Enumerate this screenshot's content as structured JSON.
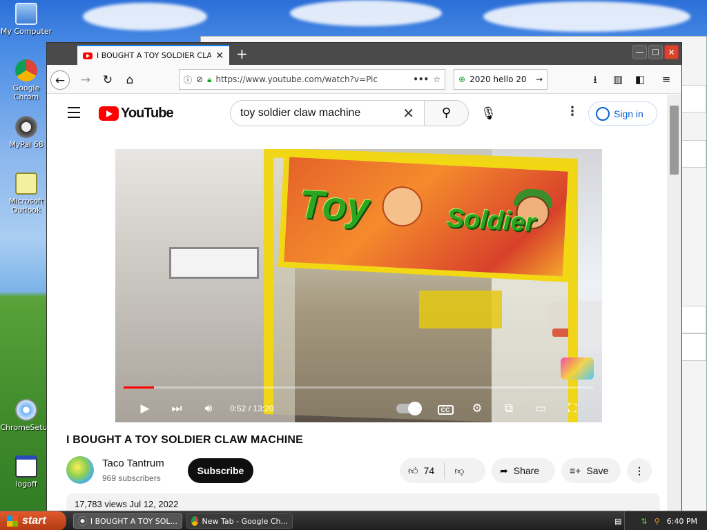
{
  "desktop": {
    "icons": [
      {
        "label": "My Computer",
        "icon": "computer-icon"
      },
      {
        "label": "Google Chrom",
        "icon": "chrome-icon"
      },
      {
        "label": "MyPal 68",
        "icon": "raccoon-icon"
      },
      {
        "label": "Microsoft Outlook",
        "icon": "outlook-icon"
      },
      {
        "label": "ChromeSetup",
        "icon": "setup-icon"
      },
      {
        "label": "logoff",
        "icon": "logoff-icon"
      }
    ]
  },
  "browser": {
    "tab_title": "I BOUGHT A TOY SOLDIER CLAW M",
    "url": "https://www.youtube.com/watch?v=Pic",
    "search_value": "2020 hello 20"
  },
  "youtube": {
    "logo_text": "YouTube",
    "search_query": "toy soldier claw machine",
    "sign_in": "Sign in",
    "video": {
      "marquee_word1": "Toy",
      "marquee_word2": "Soldier",
      "time": "0:52 / 13:20",
      "progress_fraction": 0.065,
      "title": "I BOUGHT A TOY SOLDIER CLAW MACHINE"
    },
    "channel": {
      "name": "Taco Tantrum",
      "subscribers": "969 subscribers",
      "subscribe_label": "Subscribe"
    },
    "actions": {
      "likes": "74",
      "share": "Share",
      "save": "Save"
    },
    "description_preview": "17,783 views  Jul 12, 2022"
  },
  "taskbar": {
    "start": "start",
    "items": [
      {
        "label": "I BOUGHT A TOY SOL..."
      },
      {
        "label": "New Tab - Google Ch..."
      }
    ],
    "clock": "6:40 PM"
  },
  "colors": {
    "youtube_red": "#ff0000",
    "accent_blue": "#065fd4",
    "start_orange": "#e05a2c"
  }
}
